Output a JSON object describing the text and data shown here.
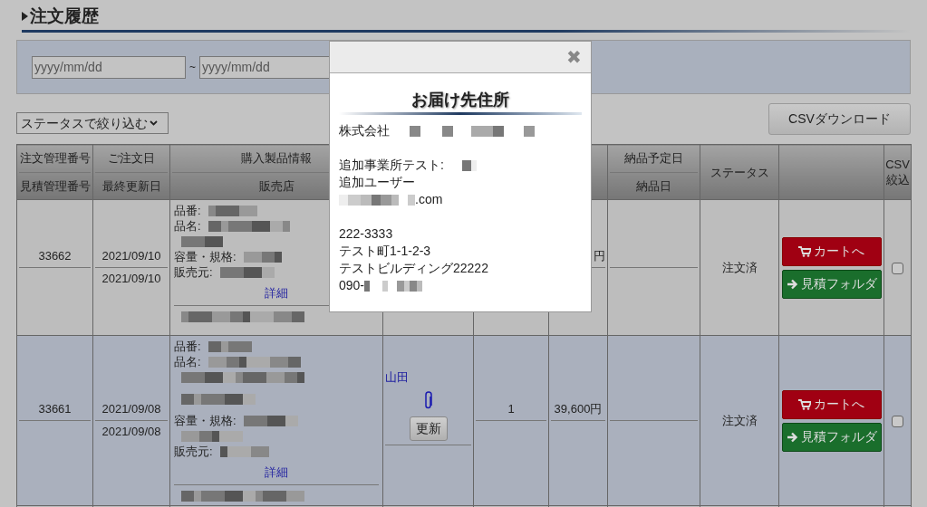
{
  "page_title": "注文履歴",
  "date_filter": {
    "from_placeholder": "yyyy/mm/dd",
    "separator": "~",
    "to_placeholder": "yyyy/mm/dd"
  },
  "status_filter": {
    "value": "ステータスで絞り込む"
  },
  "csv_button": "CSVダウンロード",
  "table": {
    "columns": [
      {
        "kind": "split",
        "top": "注文管理番号",
        "bottom": "見積管理番号"
      },
      {
        "kind": "split",
        "top": "ご注文日",
        "bottom": "最終更新日"
      },
      {
        "kind": "split",
        "top": "購入製品情報",
        "bottom": "販売店"
      },
      {
        "kind": "blank"
      },
      {
        "kind": "blank"
      },
      {
        "kind": "blank"
      },
      {
        "kind": "split",
        "top": "納品予定日",
        "bottom": "納品日"
      },
      {
        "kind": "single",
        "label": "ステータス"
      },
      {
        "kind": "blank"
      },
      {
        "kind": "single",
        "label": "CSV 絞込"
      }
    ],
    "rows": [
      {
        "selected": false,
        "order_no": "33662",
        "order_date": "2021/09/10",
        "updated": "2021/09/10",
        "product_labels": [
          "品番:",
          "品名:",
          "容量・規格:",
          "販売元:"
        ],
        "detail_link": "詳細",
        "price": "円",
        "status": "注文済",
        "cart_button": "カートへ",
        "folder_button": "見積フォルダ",
        "csv_checked": false
      },
      {
        "selected": true,
        "order_no": "33661",
        "order_date": "2021/09/08",
        "updated": "2021/09/08",
        "product_labels": [
          "品番:",
          "品名:",
          "容量・規格:",
          "販売元:"
        ],
        "detail_link": "詳細",
        "person": "山田",
        "attachment": true,
        "update_button": "更新",
        "quantity": "1",
        "price": "39,600円",
        "status": "注文済",
        "cart_button": "カートへ",
        "folder_button": "見積フォルダ",
        "csv_checked": false
      }
    ]
  },
  "modal": {
    "close": "✖",
    "title": "お届け先住所",
    "blocks": [
      {
        "lines": [
          "株式会社"
        ]
      },
      {
        "lines": [
          "追加事業所テスト:",
          "追加ユーザー",
          ".com"
        ]
      },
      {
        "lines": [
          "222-3333",
          "テスト町1-1-2-3",
          "テストビルディング22222",
          "090-"
        ]
      }
    ]
  }
}
